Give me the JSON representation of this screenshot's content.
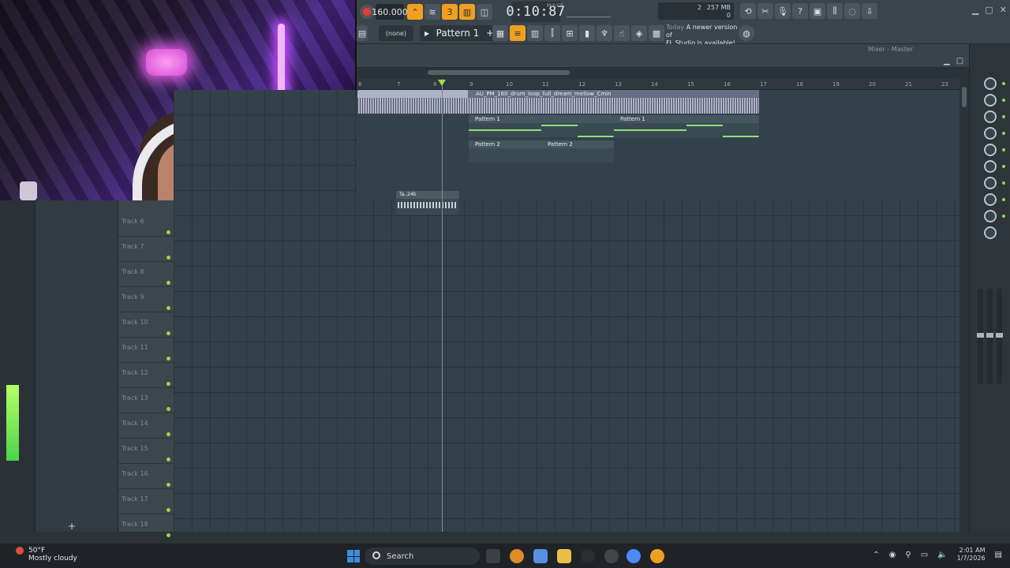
{
  "toolbar": {
    "tempo": "160.000",
    "time": "0:10:87",
    "time_unit": "M:S:CS",
    "cpu_value": "2",
    "ram": "257 MB",
    "polyphony": "0",
    "pattern_label": "Pattern 1",
    "snap": "(none)",
    "news_today": "Today",
    "news_line1": "A newer version of",
    "news_line2": "FL Studio is available!"
  },
  "window": {
    "mixer_title": "Mixer - Master"
  },
  "ruler": {
    "bars": [
      "6",
      "7",
      "8",
      "9",
      "10",
      "11",
      "12",
      "13",
      "14",
      "15",
      "16",
      "17",
      "18",
      "19",
      "20",
      "21",
      "22"
    ]
  },
  "clips": {
    "audio": "AU_PM_160_drum_loop_full_dream_mellow_Cmin",
    "pattern1_a": "Pattern 1",
    "pattern1_b": "Pattern 1",
    "pattern2_a": "Pattern 2",
    "pattern2_b": "Pattern 2",
    "small": "Ta..24b"
  },
  "tracks": [
    "Track 6",
    "Track 7",
    "Track 8",
    "Track 9",
    "Track 10",
    "Track 11",
    "Track 12",
    "Track 13",
    "Track 14",
    "Track 15",
    "Track 16",
    "Track 17",
    "Track 18"
  ],
  "taskbar": {
    "temperature": "50°F",
    "weather": "Mostly cloudy",
    "search": "Search",
    "time": "2:01 AM",
    "date": "1/7/2026"
  },
  "colors": {
    "accent": "#f0a020",
    "clip_audio": "#aeb3c7",
    "note_green": "#8fe07a",
    "record": "#e43b3b"
  }
}
